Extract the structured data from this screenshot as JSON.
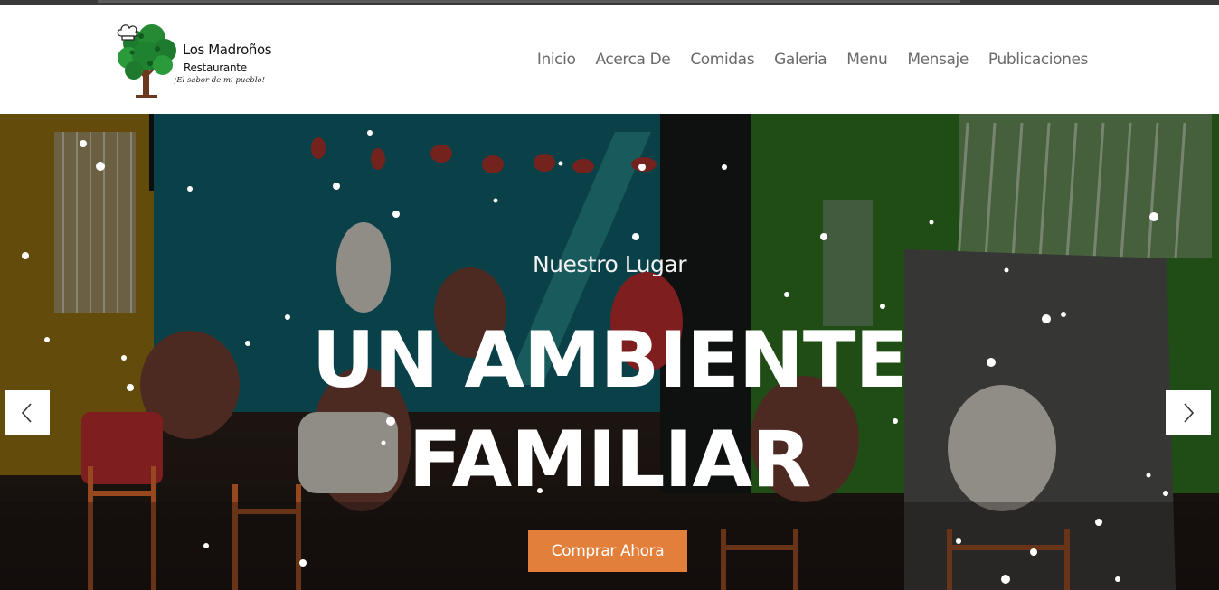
{
  "brand": {
    "name": "Los Madroños",
    "subtitle": "Restaurante",
    "tagline": "¡El sabor de mi pueblo!"
  },
  "nav": {
    "items": [
      "Inicio",
      "Acerca De",
      "Comidas",
      "Galeria",
      "Menu",
      "Mensaje",
      "Publicaciones"
    ]
  },
  "hero": {
    "kicker": "Nuestro Lugar",
    "title_line1": "UN AMBIENTE",
    "title_line2": "FAMILIAR",
    "cta_label": "Comprar Ahora"
  },
  "carousel": {
    "prev_icon": "chevron-left-icon",
    "next_icon": "chevron-right-icon"
  },
  "colors": {
    "cta": "#e2803b",
    "nav_text": "#6a6a6a",
    "header_bg": "#ffffff"
  }
}
